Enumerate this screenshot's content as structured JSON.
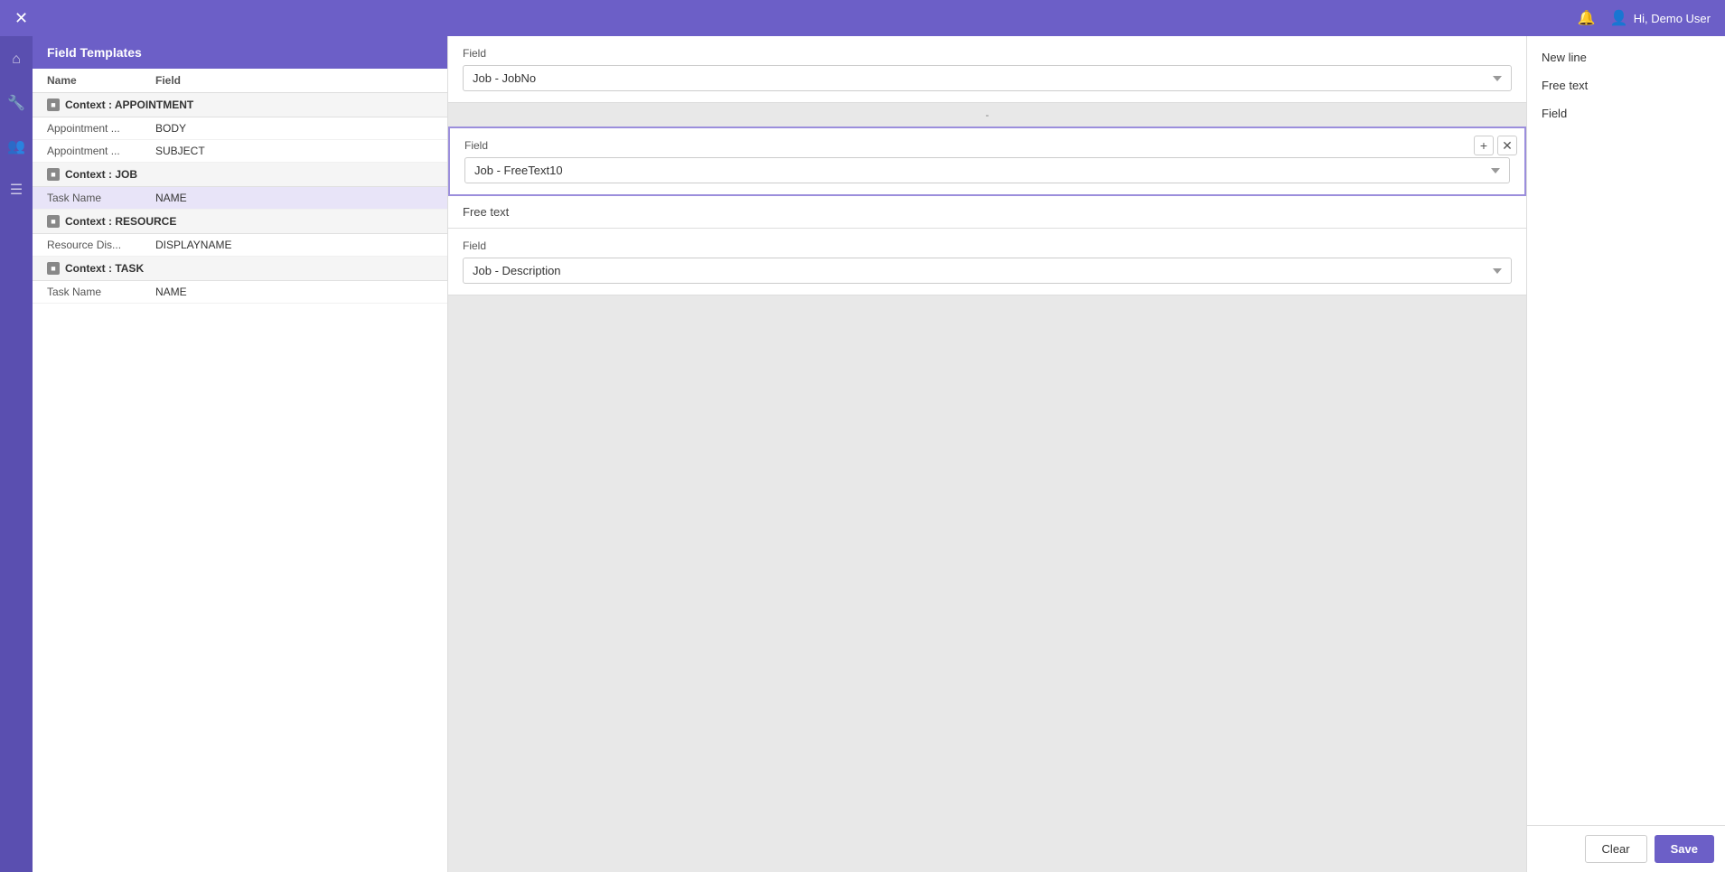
{
  "topbar": {
    "close_icon": "✕",
    "bell_icon": "🔔",
    "user_label": "Hi, Demo User",
    "user_icon": "👤"
  },
  "left_panel": {
    "title": "Field Templates",
    "columns": {
      "name": "Name",
      "field": "Field"
    },
    "contexts": [
      {
        "name": "Context : APPOINTMENT",
        "rows": [
          {
            "name": "Appointment ...",
            "field": "BODY"
          },
          {
            "name": "Appointment ...",
            "field": "SUBJECT"
          }
        ]
      },
      {
        "name": "Context : JOB",
        "rows": [
          {
            "name": "Task Name",
            "field": "NAME",
            "active": true
          }
        ]
      },
      {
        "name": "Context : RESOURCE",
        "rows": [
          {
            "name": "Resource Dis...",
            "field": "DISPLAYNAME"
          }
        ]
      },
      {
        "name": "Context : TASK",
        "rows": [
          {
            "name": "Task Name",
            "field": "NAME"
          }
        ]
      }
    ]
  },
  "center_panel": {
    "blocks": [
      {
        "type": "field",
        "label": "Field",
        "value": "Job - JobNo",
        "options": [
          "Job - JobNo",
          "Job - FreeText10",
          "Job - Description"
        ]
      },
      {
        "type": "separator",
        "value": "-"
      },
      {
        "type": "field_active",
        "label": "Field",
        "value": "Job - FreeText10",
        "options": [
          "Job - JobNo",
          "Job - FreeText10",
          "Job - Description"
        ]
      },
      {
        "type": "freetext",
        "label": "Free text"
      },
      {
        "type": "field",
        "label": "Field",
        "value": "Job - Description",
        "options": [
          "Job - JobNo",
          "Job - FreeText10",
          "Job - Description"
        ]
      }
    ]
  },
  "right_panel": {
    "options": [
      {
        "label": "New line"
      },
      {
        "label": "Free text"
      },
      {
        "label": "Field"
      }
    ],
    "clear_label": "Clear",
    "save_label": "Save"
  }
}
